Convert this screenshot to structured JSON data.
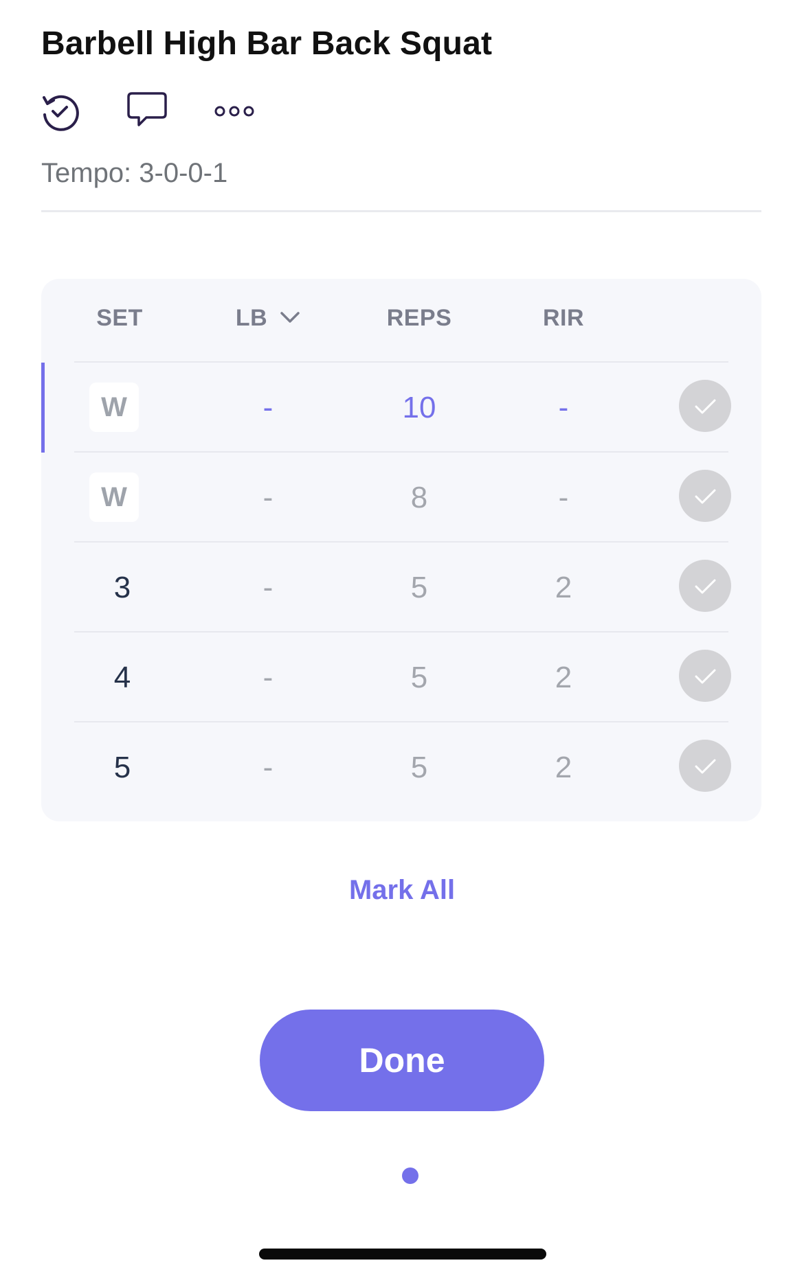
{
  "exercise": {
    "title": "Barbell High Bar Back Squat",
    "tempo": "Tempo: 3-0-0-1"
  },
  "actions": {
    "icons": [
      "history-check-icon",
      "comment-icon",
      "more-icon"
    ]
  },
  "table": {
    "headers": {
      "set": "SET",
      "lb": "LB",
      "reps": "REPS",
      "rir": "RIR"
    },
    "rows": [
      {
        "set": "W",
        "lb": "-",
        "reps": "10",
        "rir": "-",
        "warmup": true,
        "active": true
      },
      {
        "set": "W",
        "lb": "-",
        "reps": "8",
        "rir": "-",
        "warmup": true,
        "active": false
      },
      {
        "set": "3",
        "lb": "-",
        "reps": "5",
        "rir": "2",
        "warmup": false,
        "active": false
      },
      {
        "set": "4",
        "lb": "-",
        "reps": "5",
        "rir": "2",
        "warmup": false,
        "active": false
      },
      {
        "set": "5",
        "lb": "-",
        "reps": "5",
        "rir": "2",
        "warmup": false,
        "active": false
      }
    ]
  },
  "footer": {
    "mark_all": "Mark All",
    "done": "Done"
  },
  "colors": {
    "accent": "#7470ea",
    "check_inactive": "#d3d3d6",
    "card_bg": "#f6f7fb"
  }
}
